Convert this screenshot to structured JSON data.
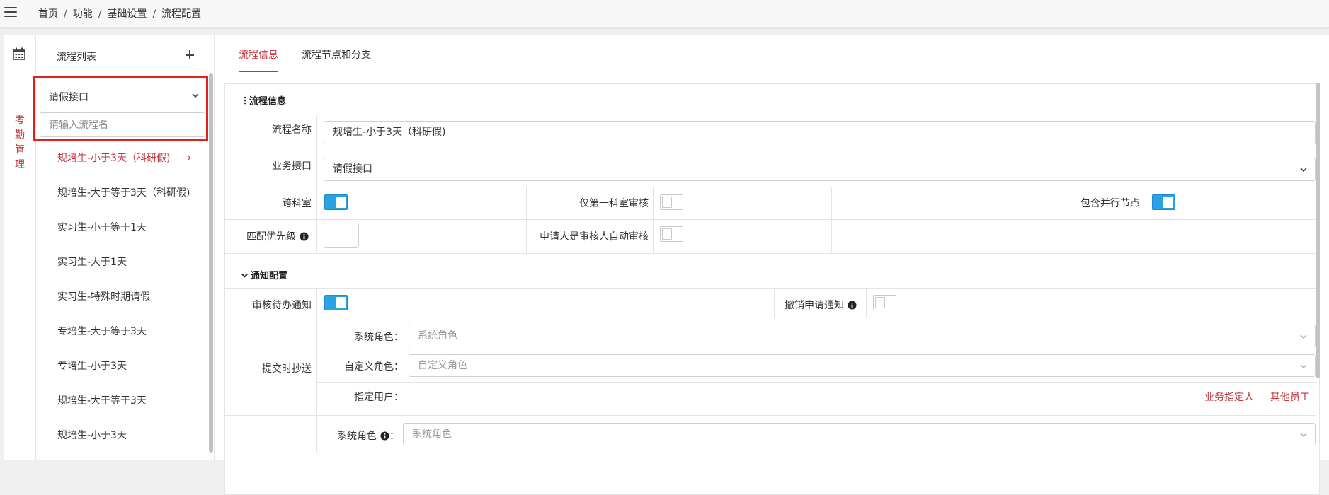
{
  "breadcrumb": [
    "首页",
    "功能",
    "基础设置",
    "流程配置"
  ],
  "breadcrumb_sep": "/",
  "side_module": "考勤管理",
  "side_module_chars": [
    "考",
    "勤",
    "管",
    "理"
  ],
  "list_panel": {
    "title": "流程列表",
    "interface_select": "请假接口",
    "search_placeholder": "请输入流程名",
    "items": [
      {
        "label": "规培生-小于3天（科研假)",
        "active": true
      },
      {
        "label": "规培生-大于等于3天（科研假)",
        "active": false
      },
      {
        "label": "实习生-小于等于1天",
        "active": false
      },
      {
        "label": "实习生-大于1天",
        "active": false
      },
      {
        "label": "实习生-特殊时期请假",
        "active": false
      },
      {
        "label": "专培生-大于等于3天",
        "active": false
      },
      {
        "label": "专培生-小于3天",
        "active": false
      },
      {
        "label": "规培生-大于等于3天",
        "active": false
      },
      {
        "label": "规培生-小于3天",
        "active": false
      }
    ]
  },
  "tabs": [
    {
      "label": "流程信息",
      "active": true
    },
    {
      "label": "流程节点和分支",
      "active": false
    }
  ],
  "flow_info": {
    "section_title": "流程信息",
    "name_label": "流程名称",
    "name_value": "规培生-小于3天（科研假)",
    "interface_label": "业务接口",
    "interface_value": "请假接口",
    "cross_dept_label": "跨科室",
    "cross_dept_on": true,
    "first_dept_only_label": "仅第一科室审核",
    "first_dept_only_on": false,
    "include_parallel_label": "包含并行节点",
    "include_parallel_on": true,
    "priority_label": "匹配优先级",
    "priority_value": "",
    "applicant_auto_label": "申请人是审核人自动审核",
    "applicant_auto_on": false
  },
  "notify": {
    "section_title": "通知配置",
    "todo_label": "审核待办通知",
    "todo_on": true,
    "revoke_label": "撤销申请通知",
    "revoke_on": false,
    "cc_label": "提交时抄送",
    "sys_role_label": "系统角色：",
    "sys_role_placeholder": "系统角色",
    "custom_role_label": "自定义角色：",
    "custom_role_placeholder": "自定义角色",
    "user_label": "指定用户：",
    "biz_assignee": "业务指定人",
    "other_staff": "其他员工",
    "sys_role2_label": "系统角色",
    "sys_role2_colon": "：",
    "sys_role2_placeholder": "系统角色"
  },
  "colors": {
    "accent": "#c0353b",
    "toggle_on": "#29a3e2",
    "highlight_box": "#e0211c"
  },
  "icons": [
    "menu-icon",
    "calendar-icon",
    "plus-icon",
    "chevron-down-icon",
    "chevron-right-icon",
    "info-icon",
    "vertical-dots-icon"
  ]
}
